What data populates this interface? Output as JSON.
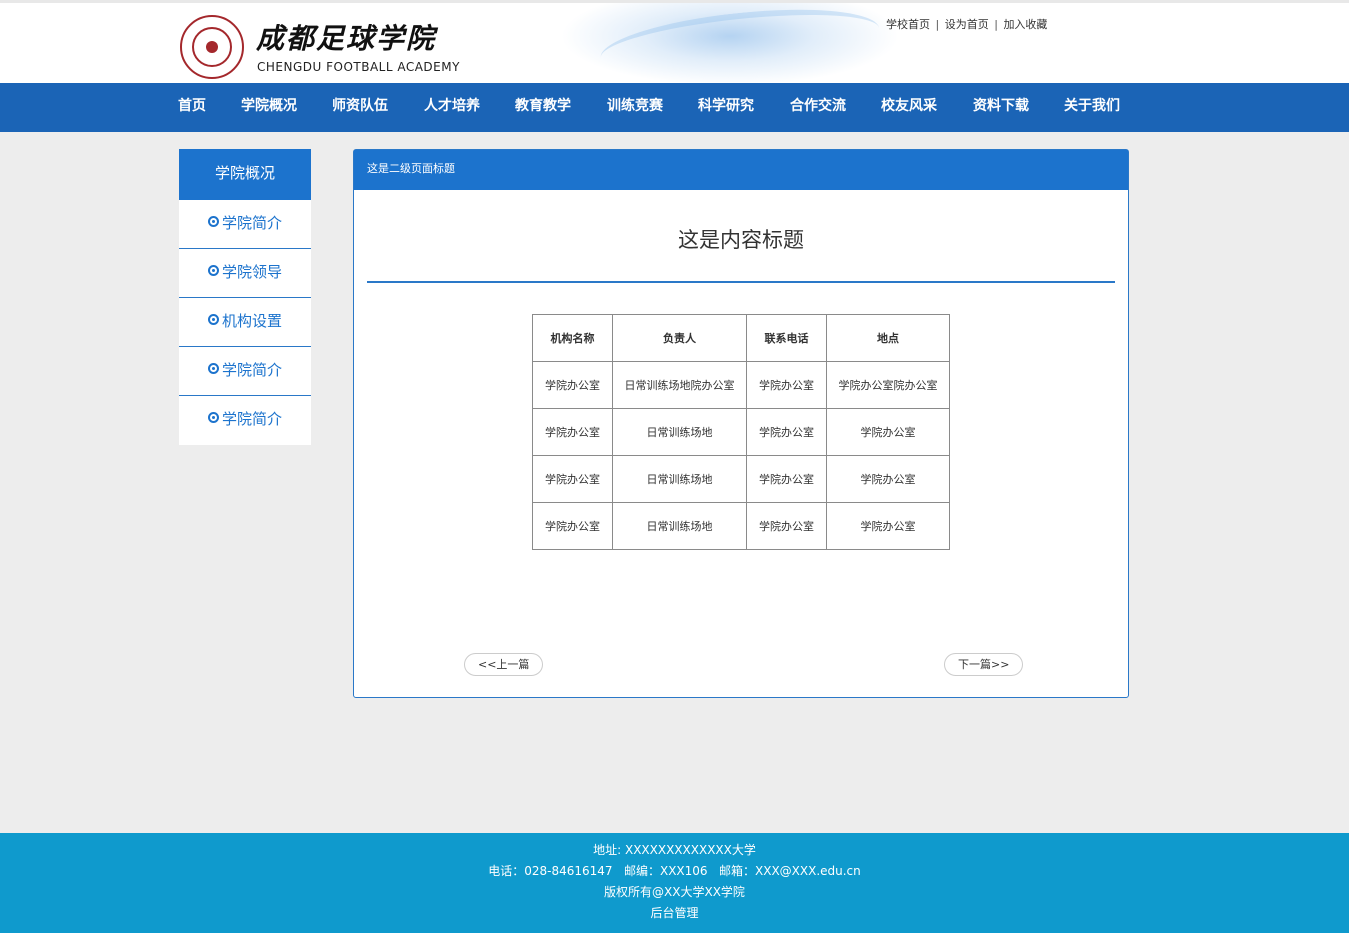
{
  "header": {
    "logo_cn": "成都足球学院",
    "logo_en": "CHENGDU FOOTBALL ACADEMY",
    "top_links": [
      "学校首页",
      "设为首页",
      "加入收藏"
    ]
  },
  "nav": {
    "items": [
      "首页",
      "学院概况",
      "师资队伍",
      "人才培养",
      "教育教学",
      "训练竞赛",
      "科学研究",
      "合作交流",
      "校友风采",
      "资料下载",
      "关于我们"
    ]
  },
  "sidebar": {
    "title": "学院概况",
    "items": [
      "学院简介",
      "学院领导",
      "机构设置",
      "学院简介",
      "学院简介"
    ]
  },
  "panel": {
    "heading": "这是二级页面标题",
    "content_title": "这是内容标题",
    "table": {
      "headers": [
        "机构名称",
        "负责人",
        "联系电话",
        "地点"
      ],
      "rows": [
        [
          "学院办公室",
          "日常训练场地院办公室",
          "学院办公室",
          "学院办公室院办公室"
        ],
        [
          "学院办公室",
          "日常训练场地",
          "学院办公室",
          "学院办公室"
        ],
        [
          "学院办公室",
          "日常训练场地",
          "学院办公室",
          "学院办公室"
        ],
        [
          "学院办公室",
          "日常训练场地",
          "学院办公室",
          "学院办公室"
        ]
      ]
    },
    "prev_label": "<<上一篇",
    "next_label": "下一篇>>"
  },
  "footer": {
    "address": "地址: XXXXXXXXXXXXX大学",
    "contact": "电话：028-84616147   邮编：XXX106   邮箱：XXX@XXX.edu.cn",
    "copyright": "版权所有@XX大学XX学院",
    "admin": "后台管理"
  },
  "colors": {
    "nav_bg": "#1b64b6",
    "accent": "#1c73cd",
    "footer_bg": "#0f9acd",
    "page_bg": "#ededed",
    "logo_red": "#a4282c"
  },
  "icons": {
    "sidebar_bullet": "circle-dot-icon",
    "logo": "academy-seal-logo"
  }
}
